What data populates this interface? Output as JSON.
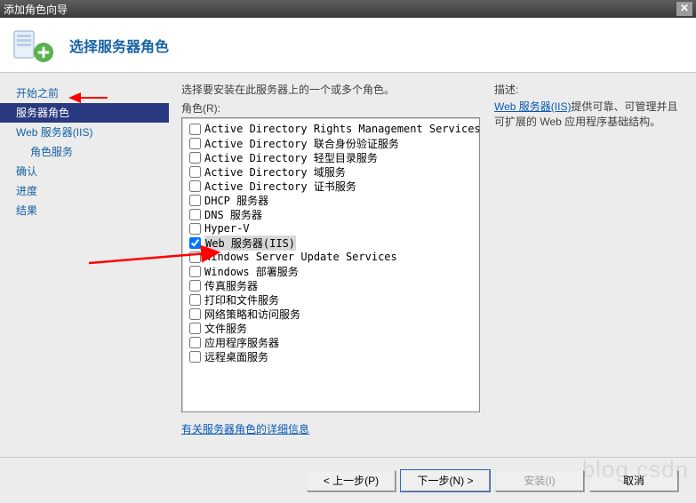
{
  "window": {
    "title": "添加角色向导"
  },
  "header": {
    "heading": "选择服务器角色"
  },
  "sidebar": {
    "items": [
      {
        "label": "开始之前",
        "selected": false,
        "indent": false
      },
      {
        "label": "服务器角色",
        "selected": true,
        "indent": false
      },
      {
        "label": "Web 服务器(IIS)",
        "selected": false,
        "indent": false
      },
      {
        "label": "角色服务",
        "selected": false,
        "indent": true
      },
      {
        "label": "确认",
        "selected": false,
        "indent": false
      },
      {
        "label": "进度",
        "selected": false,
        "indent": false
      },
      {
        "label": "结果",
        "selected": false,
        "indent": false
      }
    ]
  },
  "main": {
    "instruction": "选择要安装在此服务器上的一个或多个角色。",
    "roles_label": "角色(R):",
    "more_info_link": "有关服务器角色的详细信息",
    "roles": [
      {
        "label": "Active Directory Rights Management Services",
        "checked": false
      },
      {
        "label": "Active Directory 联合身份验证服务",
        "checked": false
      },
      {
        "label": "Active Directory 轻型目录服务",
        "checked": false
      },
      {
        "label": "Active Directory 域服务",
        "checked": false
      },
      {
        "label": "Active Directory 证书服务",
        "checked": false
      },
      {
        "label": "DHCP 服务器",
        "checked": false
      },
      {
        "label": "DNS 服务器",
        "checked": false
      },
      {
        "label": "Hyper-V",
        "checked": false
      },
      {
        "label": "Web 服务器(IIS)",
        "checked": true,
        "highlight": true
      },
      {
        "label": "Windows Server Update Services",
        "checked": false
      },
      {
        "label": "Windows 部署服务",
        "checked": false
      },
      {
        "label": "传真服务器",
        "checked": false
      },
      {
        "label": "打印和文件服务",
        "checked": false
      },
      {
        "label": "网络策略和访问服务",
        "checked": false
      },
      {
        "label": "文件服务",
        "checked": false
      },
      {
        "label": "应用程序服务器",
        "checked": false
      },
      {
        "label": "远程桌面服务",
        "checked": false
      }
    ]
  },
  "description": {
    "title": "描述:",
    "link_text": "Web 服务器(IIS)",
    "body_after_link": "提供可靠、可管理并且可扩展的 Web 应用程序基础结构。"
  },
  "footer": {
    "back": "< 上一步(P)",
    "next": "下一步(N) >",
    "install": "安装(I)",
    "cancel": "取消"
  }
}
